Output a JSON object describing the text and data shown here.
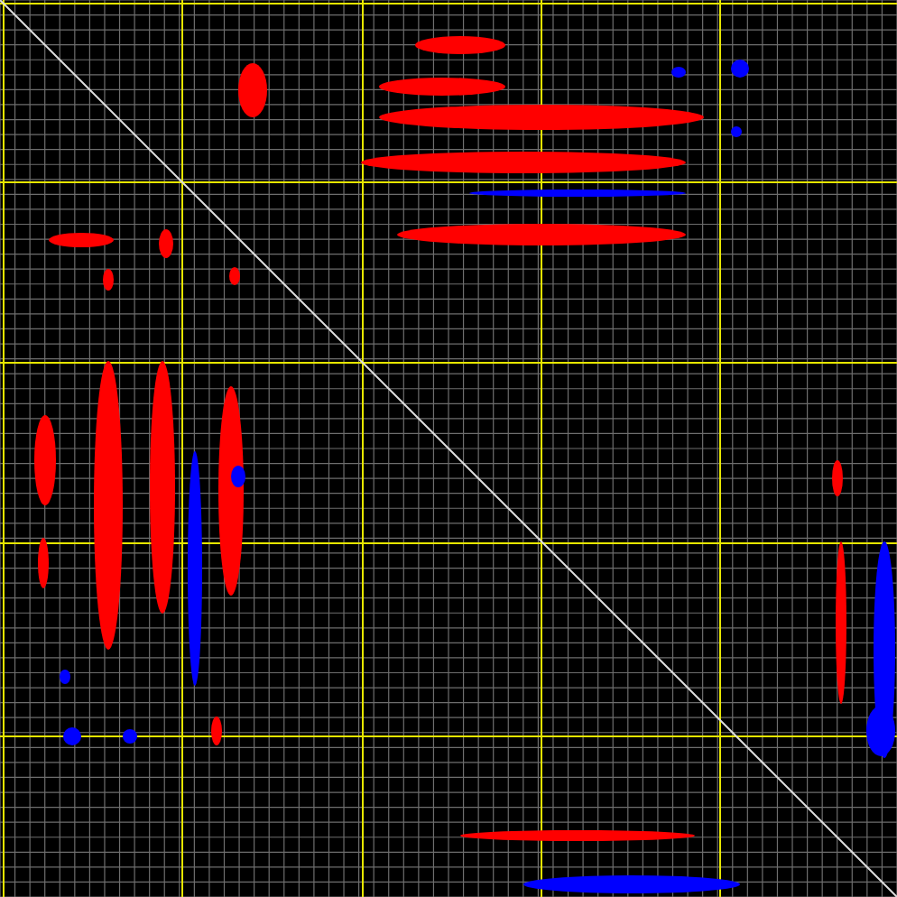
{
  "spectrum": {
    "phases": [
      {
        "color": "#ff0000"
      },
      {
        "color": "#0000ff"
      }
    ]
  }
}
